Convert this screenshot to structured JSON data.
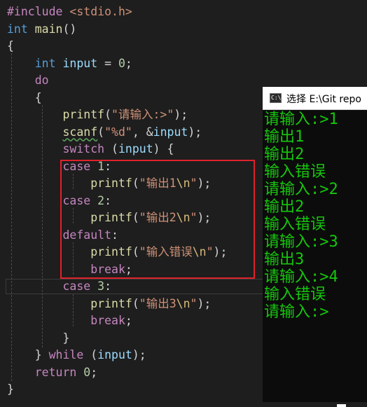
{
  "editor": {
    "lines": [
      [
        [
          "inc",
          "#include "
        ],
        [
          "str",
          "<stdio.h>"
        ]
      ],
      [
        [
          "kw",
          "int"
        ],
        [
          "pun",
          " "
        ],
        [
          "fn",
          "main"
        ],
        [
          "pun",
          "()"
        ]
      ],
      [
        [
          "pun",
          "{"
        ]
      ],
      [
        [
          "pun",
          "    "
        ],
        [
          "kw",
          "int"
        ],
        [
          "pun",
          " "
        ],
        [
          "var",
          "input"
        ],
        [
          "pun",
          " = "
        ],
        [
          "num",
          "0"
        ],
        [
          "pun",
          ";"
        ]
      ],
      [
        [
          "pun",
          "    "
        ],
        [
          "kw2",
          "do"
        ]
      ],
      [
        [
          "pun",
          "    {"
        ]
      ],
      [
        [
          "pun",
          "        "
        ],
        [
          "fn",
          "printf"
        ],
        [
          "pun",
          "("
        ],
        [
          "str",
          "\"请输入:>\""
        ],
        [
          "pun",
          ");"
        ]
      ],
      [
        [
          "pun",
          "        "
        ],
        [
          "fn",
          "scanf"
        ],
        [
          "pun",
          "("
        ],
        [
          "str",
          "\"%d\""
        ],
        [
          "pun",
          ", &"
        ],
        [
          "var",
          "input"
        ],
        [
          "pun",
          ");"
        ]
      ],
      [
        [
          "pun",
          "        "
        ],
        [
          "kw2",
          "switch"
        ],
        [
          "pun",
          " ("
        ],
        [
          "var",
          "input"
        ],
        [
          "pun",
          ") {"
        ]
      ],
      [
        [
          "pun",
          "        "
        ],
        [
          "kw2",
          "case"
        ],
        [
          "pun",
          " "
        ],
        [
          "num",
          "1"
        ],
        [
          "pun",
          ":"
        ]
      ],
      [
        [
          "pun",
          "            "
        ],
        [
          "fn",
          "printf"
        ],
        [
          "pun",
          "("
        ],
        [
          "str",
          "\"输出1"
        ],
        [
          "esc",
          "\\n"
        ],
        [
          "str",
          "\""
        ],
        [
          "pun",
          ");"
        ]
      ],
      [
        [
          "pun",
          "        "
        ],
        [
          "kw2",
          "case"
        ],
        [
          "pun",
          " "
        ],
        [
          "num",
          "2"
        ],
        [
          "pun",
          ":"
        ]
      ],
      [
        [
          "pun",
          "            "
        ],
        [
          "fn",
          "printf"
        ],
        [
          "pun",
          "("
        ],
        [
          "str",
          "\"输出2"
        ],
        [
          "esc",
          "\\n"
        ],
        [
          "str",
          "\""
        ],
        [
          "pun",
          ");"
        ]
      ],
      [
        [
          "pun",
          "        "
        ],
        [
          "kw2",
          "default"
        ],
        [
          "pun",
          ":"
        ]
      ],
      [
        [
          "pun",
          "            "
        ],
        [
          "fn",
          "printf"
        ],
        [
          "pun",
          "("
        ],
        [
          "str",
          "\"输入错误"
        ],
        [
          "esc",
          "\\n"
        ],
        [
          "str",
          "\""
        ],
        [
          "pun",
          ");"
        ]
      ],
      [
        [
          "pun",
          "            "
        ],
        [
          "kw2",
          "break"
        ],
        [
          "pun",
          ";"
        ]
      ],
      [
        [
          "pun",
          "        "
        ],
        [
          "kw2",
          "case"
        ],
        [
          "pun",
          " "
        ],
        [
          "num",
          "3"
        ],
        [
          "pun",
          ":"
        ]
      ],
      [
        [
          "pun",
          "            "
        ],
        [
          "fn",
          "printf"
        ],
        [
          "pun",
          "("
        ],
        [
          "str",
          "\"输出3"
        ],
        [
          "esc",
          "\\n"
        ],
        [
          "str",
          "\""
        ],
        [
          "pun",
          ");"
        ]
      ],
      [
        [
          "pun",
          "            "
        ],
        [
          "kw2",
          "break"
        ],
        [
          "pun",
          ";"
        ]
      ],
      [
        [
          "pun",
          "        }"
        ]
      ],
      [
        [
          "pun",
          "    } "
        ],
        [
          "kw2",
          "while"
        ],
        [
          "pun",
          " ("
        ],
        [
          "var",
          "input"
        ],
        [
          "pun",
          ");"
        ]
      ],
      [
        [
          "pun",
          "    "
        ],
        [
          "kw2",
          "return"
        ],
        [
          "pun",
          " "
        ],
        [
          "num",
          "0"
        ],
        [
          "pun",
          ";"
        ]
      ],
      [
        [
          "pun",
          "}"
        ]
      ]
    ]
  },
  "console": {
    "title": "选择 E:\\Git repo",
    "icon_label": "C:\\",
    "output": [
      "请输入:>1",
      "输出1",
      "输出2",
      "输入错误",
      "请输入:>2",
      "输出2",
      "输入错误",
      "请输入:>3",
      "输出3",
      "请输入:>4",
      "输入错误",
      "请输入:>"
    ]
  },
  "colors": {
    "editor_bg": "#1e1e1e",
    "console_bg": "#0c0c0c",
    "console_text": "#16c60c",
    "highlight_box": "#e0212b"
  }
}
